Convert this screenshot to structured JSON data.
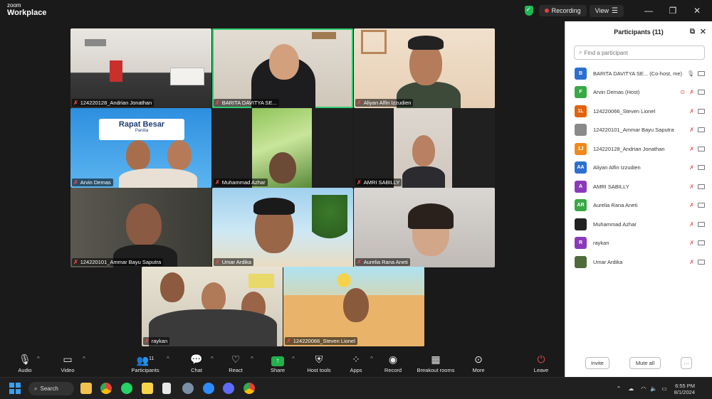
{
  "app": {
    "brand_top": "zoom",
    "brand_bottom": "Workplace"
  },
  "titlebar": {
    "recording": "Recording",
    "view": "View",
    "view_glyph": "☰",
    "minimize": "—",
    "maximize": "❐",
    "close": "✕"
  },
  "tiles": [
    {
      "name": "124220128_Andrian Jonathan"
    },
    {
      "name": "BARITA DAVITYA SE...",
      "active": true
    },
    {
      "name": "Aliyan Alfin Izzudien"
    },
    {
      "name": "Arvin Demas",
      "banner_title": "Rapat Besar",
      "banner_sub": "Panitia"
    },
    {
      "name": "Muhammad Azhar"
    },
    {
      "name": "AMRI SABILLY"
    },
    {
      "name": "124220101_Ammar Bayu Saputra"
    },
    {
      "name": "Umar Ardika"
    },
    {
      "name": "Aurelia Rana Aneti"
    },
    {
      "name": "raykan"
    },
    {
      "name": "124220066_Steven Lionel"
    }
  ],
  "toolbar": {
    "audio": "Audio",
    "video": "Video",
    "participants": "Participants",
    "participants_count": "11",
    "chat": "Chat",
    "react": "React",
    "share": "Share",
    "host_tools": "Host tools",
    "apps": "Apps",
    "record": "Record",
    "breakout": "Breakout rooms",
    "more": "More",
    "leave": "Leave"
  },
  "panel": {
    "title": "Participants (11)",
    "search_placeholder": "Find a participant",
    "participants": [
      {
        "initials": "B",
        "name": "BARITA DAVITYA SE... (Co-host, me)",
        "color": "#2d6fd1"
      },
      {
        "initials": "F",
        "name": "Arvin Demas (Host)",
        "color": "#39a845"
      },
      {
        "initials": "1L",
        "name": "124220066_Steven Lionel",
        "color": "#e2620f"
      },
      {
        "initials": "",
        "name": "124220101_Ammar Bayu Saputra",
        "color": "#8a8a8a"
      },
      {
        "initials": "1J",
        "name": "124220128_Andrian Jonathan",
        "color": "#f08a1c"
      },
      {
        "initials": "AA",
        "name": "Aliyan Alfin Izzudien",
        "color": "#2d6fd1"
      },
      {
        "initials": "A",
        "name": "AMRI SABILLY",
        "color": "#8a3ab9"
      },
      {
        "initials": "AR",
        "name": "Aurelia Rana Aneti",
        "color": "#39a845"
      },
      {
        "initials": "",
        "name": "Muhammad Azhar",
        "color": "#222222"
      },
      {
        "initials": "R",
        "name": "raykan",
        "color": "#8a3ab9"
      },
      {
        "initials": "",
        "name": "Umar Ardika",
        "color": "#4f6b3a"
      }
    ],
    "invite": "Invite",
    "mute_all": "Mute all",
    "more": "···"
  },
  "taskbar": {
    "search": "Search",
    "time": "6:55 PM",
    "date": "8/1/2024"
  }
}
